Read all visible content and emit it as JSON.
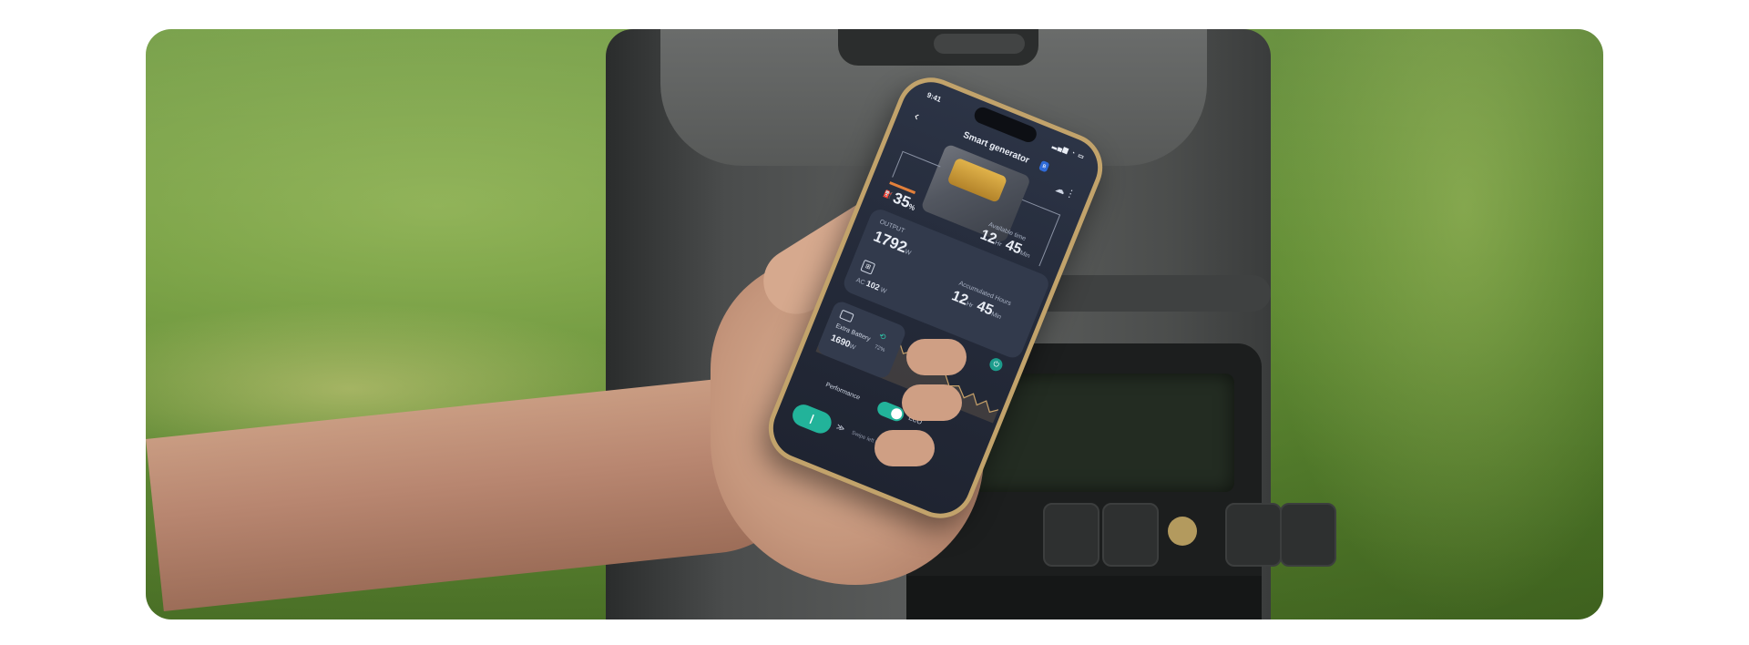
{
  "app": {
    "status_time": "9:41",
    "title": "Smart generator",
    "bluetooth_icon": "ʙ",
    "fuel_value": "35",
    "fuel_unit": "%",
    "run_time_label": "Available time",
    "run_time_hours": "12",
    "run_time_minutes": "45",
    "hour_unit": "Hr",
    "minute_unit": "Min",
    "output_label": "OUTPUT",
    "output_value": "1792",
    "output_unit": "W",
    "accumulated_label": "Accumulated Hours",
    "accumulated_hours": "12",
    "accumulated_minutes": "45",
    "ac_label": "AC",
    "ac_value": "102",
    "ac_unit": "W",
    "battery_label": "Extra Battery",
    "battery_value": "1690",
    "battery_unit": "W",
    "battery_percent": "72%",
    "mode_left": "Performance",
    "mode_right": "ECO",
    "swipe_glyph": "|",
    "swipe_arrows": "≫",
    "swipe_hint": "Swipe left to turn off the engine"
  },
  "icons": {
    "back": "‹",
    "cloud": "☁",
    "more": "⋮",
    "fuel": "⛽",
    "outlet": "⊞",
    "power": "⏻",
    "charge": "⟲"
  },
  "colors": {
    "accent": "#22b39a",
    "fuel_bar": "#e3803a",
    "phone_frame": "#c2a36b"
  }
}
